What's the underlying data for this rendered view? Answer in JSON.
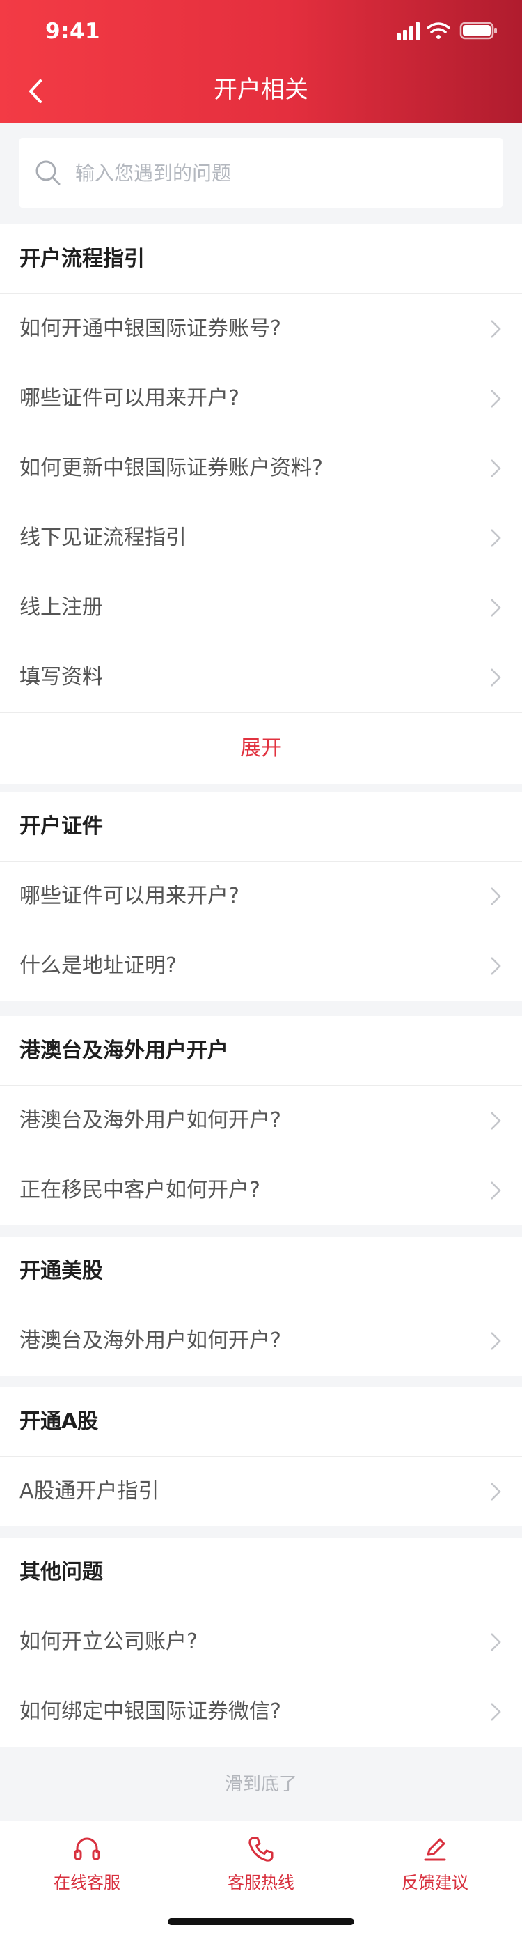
{
  "status_bar": {
    "time": "9:41"
  },
  "nav": {
    "title": "开户相关"
  },
  "search": {
    "placeholder": "输入您遇到的问题",
    "value": ""
  },
  "sections": [
    {
      "title": "开户流程指引",
      "items": [
        "如何开通中银国际证券账号?",
        "哪些证件可以用来开户?",
        "如何更新中银国际证券账户资料?",
        "线下见证流程指引",
        "线上注册",
        "填写资料"
      ],
      "expand_label": "展开"
    },
    {
      "title": "开户证件",
      "items": [
        "哪些证件可以用来开户?",
        "什么是地址证明?"
      ]
    },
    {
      "title": "港澳台及海外用户开户",
      "items": [
        "港澳台及海外用户如何开户?",
        "正在移民中客户如何开户?"
      ]
    },
    {
      "title": "开通美股",
      "items": [
        "港澳台及海外用户如何开户?"
      ]
    },
    {
      "title": "开通A股",
      "items": [
        "A股通开户指引"
      ]
    },
    {
      "title": "其他问题",
      "items": [
        "如何开立公司账户?",
        "如何绑定中银国际证券微信?"
      ]
    }
  ],
  "end_note": "滑到底了",
  "tabbar": {
    "tabs": [
      {
        "label": "在线客服",
        "icon": "headset-icon"
      },
      {
        "label": "客服热线",
        "icon": "phone-icon"
      },
      {
        "label": "反馈建议",
        "icon": "pencil-icon"
      }
    ]
  },
  "colors": {
    "accent": "#e1323f",
    "header_start": "#f33b45",
    "header_end": "#b01c2e",
    "page_bg": "#f4f5f7"
  }
}
